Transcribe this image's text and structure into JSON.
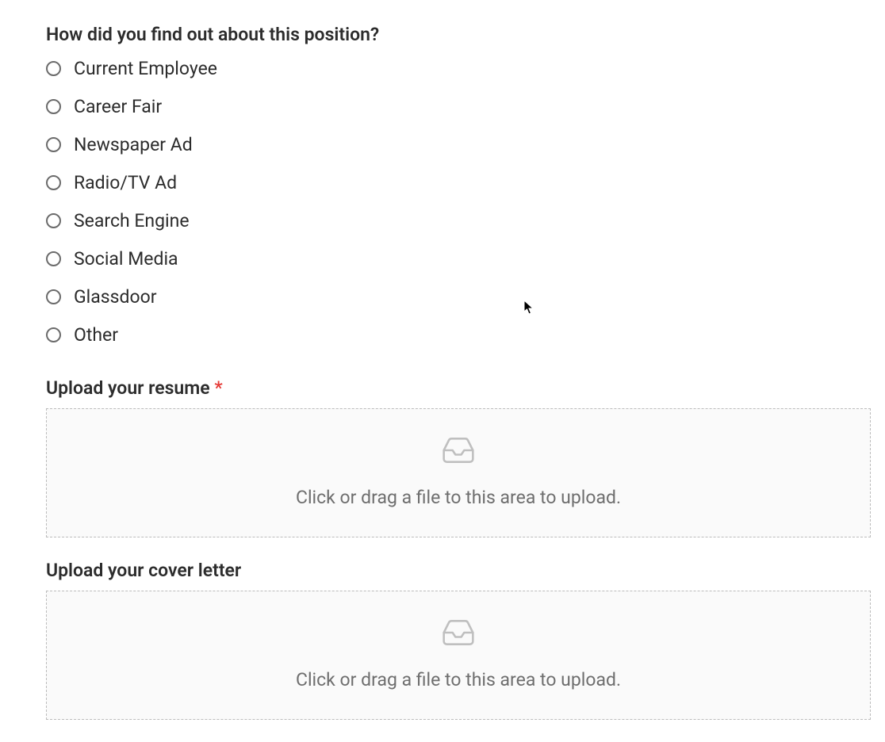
{
  "question1": {
    "label": "How did you find out about this position?",
    "options": [
      "Current Employee",
      "Career Fair",
      "Newspaper Ad",
      "Radio/TV Ad",
      "Search Engine",
      "Social Media",
      "Glassdoor",
      "Other"
    ]
  },
  "upload_resume": {
    "label": "Upload your resume ",
    "required_marker": "*",
    "hint": "Click or drag a file to this area to upload."
  },
  "upload_cover_letter": {
    "label": "Upload your cover letter",
    "hint": "Click or drag a file to this area to upload."
  }
}
